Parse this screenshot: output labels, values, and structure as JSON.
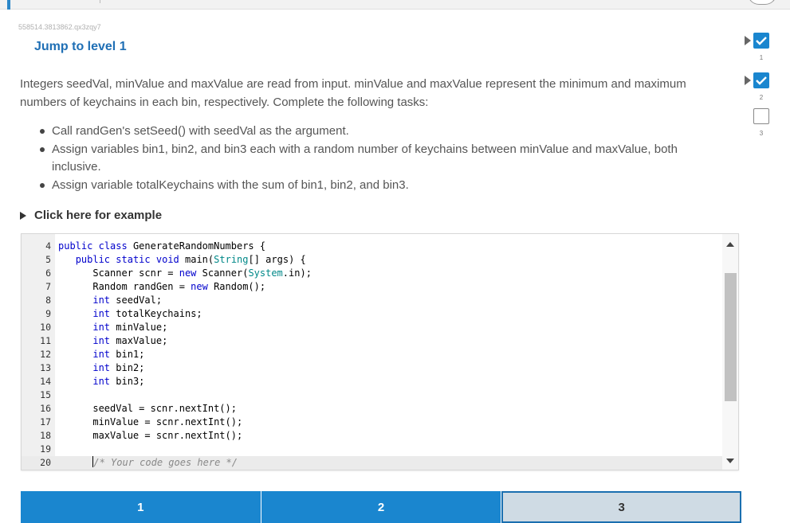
{
  "activity_id": "558514.3813862.qx3zqy7",
  "level_title": "Jump to level 1",
  "prompt": "Integers seedVal, minValue and maxValue are read from input. minValue and maxValue represent the minimum and maximum numbers of keychains in each bin, respectively. Complete the following tasks:",
  "tasks": [
    "Call randGen's setSeed() with seedVal as the argument.",
    "Assign variables bin1, bin2, and bin3 each with a random number of keychains between minValue and maxValue, both inclusive.",
    "Assign variable totalKeychains with the sum of bin1, bin2, and bin3."
  ],
  "example_toggle_label": "Click here for example",
  "code": {
    "line_numbers": [
      "4",
      "5",
      "6",
      "7",
      "8",
      "9",
      "10",
      "11",
      "12",
      "13",
      "14",
      "15",
      "16",
      "17",
      "18",
      "19",
      "20"
    ],
    "lines": [
      "public class GenerateRandomNumbers {",
      "   public static void main(String[] args) {",
      "      Scanner scnr = new Scanner(System.in);",
      "      Random randGen = new Random();",
      "      int seedVal;",
      "      int totalKeychains;",
      "      int minValue;",
      "      int maxValue;",
      "      int bin1;",
      "      int bin2;",
      "      int bin3;",
      "",
      "      seedVal = scnr.nextInt();",
      "      minValue = scnr.nextInt();",
      "      maxValue = scnr.nextInt();",
      "",
      "      /* Your code goes here */"
    ]
  },
  "level_buttons": [
    {
      "label": "1",
      "state": "done"
    },
    {
      "label": "2",
      "state": "done"
    },
    {
      "label": "3",
      "state": "current"
    }
  ],
  "progress": [
    {
      "number": "1",
      "state": "done"
    },
    {
      "number": "2",
      "state": "done"
    },
    {
      "number": "3",
      "state": "todo"
    }
  ],
  "colors": {
    "accent": "#1a86cf",
    "title": "#1f6fb5",
    "current_level_bg": "#cfdbe4"
  }
}
